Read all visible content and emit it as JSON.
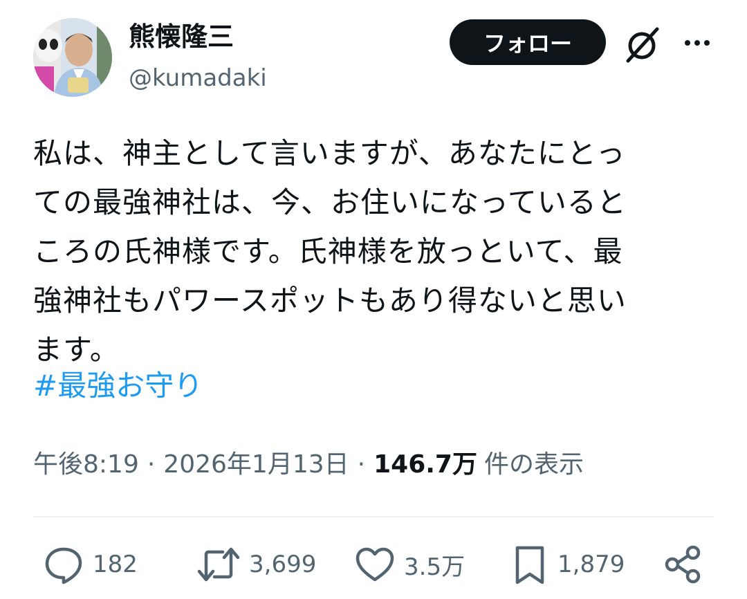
{
  "author": {
    "display_name": "熊懐隆三",
    "handle": "@kumadaki"
  },
  "header": {
    "follow_label": "フォロー"
  },
  "post": {
    "text": "私は、神主として言いますが、あなたにとっ\nての最強神社は、今、お住いになっていると\nころの氏神様です。氏神様を放っといて、最\n強神社もパワースポットもあり得ないと思い\nます。",
    "hashtag": "#最強お守り"
  },
  "meta": {
    "time": "午後8:19",
    "date": "2026年1月13日",
    "views": "146.7万",
    "views_label": "件の表示",
    "separator": "·"
  },
  "actions": {
    "replies": "182",
    "reposts": "3,699",
    "likes": "3.5万",
    "bookmarks": "1,879"
  },
  "colors": {
    "link": "#1d9bf0",
    "secondary_text": "#536471",
    "primary_text": "#0f1419",
    "button_bg": "#0f1419"
  }
}
